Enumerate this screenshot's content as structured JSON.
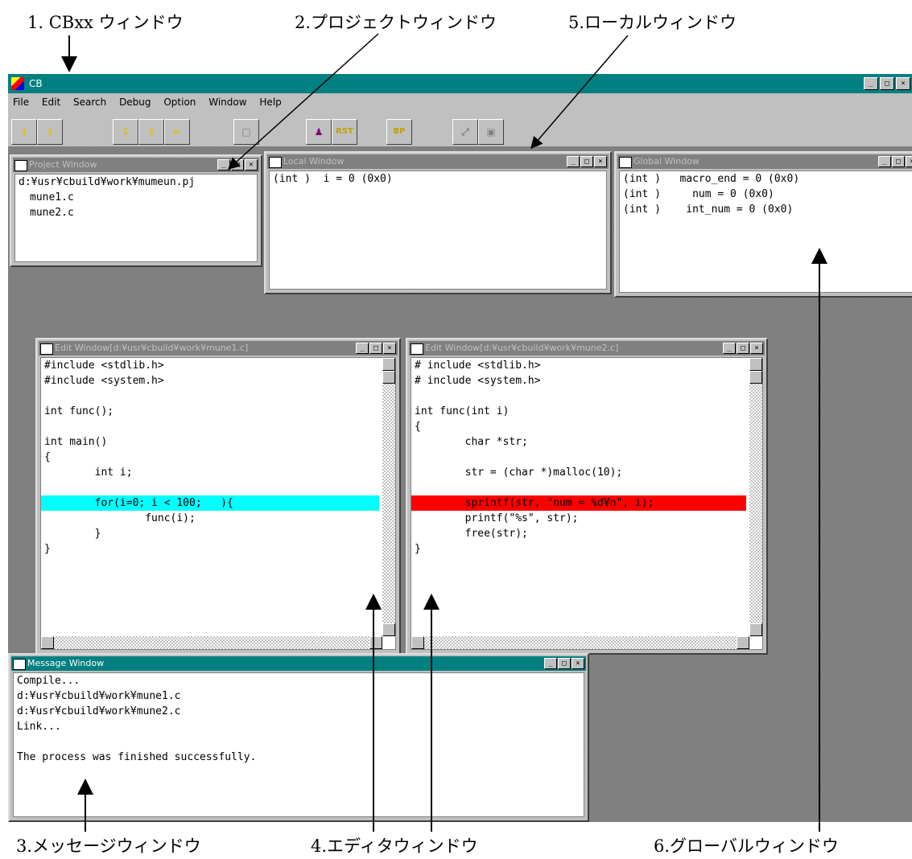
{
  "callouts": {
    "c1": "1. CBxx ウィンドウ",
    "c2": "2.プロジェクトウィンドウ",
    "c3": "3.メッセージウィンドウ",
    "c4": "4.エディタウィンドウ",
    "c5": "5.ローカルウィンドウ",
    "c6": "6.グローバルウィンドウ"
  },
  "app": {
    "title": "CB",
    "menu": [
      "File",
      "Edit",
      "Search",
      "Debug",
      "Option",
      "Window",
      "Help"
    ]
  },
  "toolbar": {
    "buttons": [
      "↓",
      "⇓",
      "↧",
      "⇩",
      "↵",
      "□",
      "♟",
      "RST",
      "BP",
      "⤢",
      "▣"
    ]
  },
  "project_window": {
    "title": "Project Window",
    "lines": [
      "d:¥usr¥cbuild¥work¥mumeun.pj",
      "mune1.c",
      "mune2.c"
    ]
  },
  "local_window": {
    "title": "Local Window",
    "lines": [
      "(int )  i = 0 (0x0)"
    ]
  },
  "global_window": {
    "title": "Global Window",
    "lines": [
      "(int )   macro_end = 0 (0x0)",
      "(int )     num = 0 (0x0)",
      "(int )    int_num = 0 (0x0)"
    ]
  },
  "editor1": {
    "title": "Edit Window[d:¥usr¥cbuild¥work¥mune1.c]",
    "lines": [
      "#include <stdlib.h>",
      "#include <system.h>",
      "",
      "int func();",
      "",
      "int main()",
      "{",
      "        int i;",
      "",
      "        for(i=0; i < 100;   ){",
      "                func(i);",
      "        }",
      "}"
    ],
    "highlight_line": 9
  },
  "editor2": {
    "title": "Edit Window[d:¥usr¥cbuild¥work¥mune2.c]",
    "lines": [
      "# include <stdlib.h>",
      "# include <system.h>",
      "",
      "int func(int i)",
      "{",
      "        char *str;",
      "",
      "        str = (char *)malloc(10);",
      "",
      "        sprintf(str, \"num = %d¥n\", i);",
      "        printf(\"%s\", str);",
      "        free(str);",
      "}"
    ],
    "highlight_line": 9
  },
  "message_window": {
    "title": "Message Window",
    "lines": [
      "Compile...",
      "d:¥usr¥cbuild¥work¥mune1.c",
      "d:¥usr¥cbuild¥work¥mune2.c",
      "Link...",
      "",
      "The process was finished successfully."
    ]
  },
  "colors": {
    "titlebar_active": "#008080",
    "desktop": "#808080",
    "highlight_cyan": "#00ffff",
    "highlight_red": "#ff0000"
  }
}
